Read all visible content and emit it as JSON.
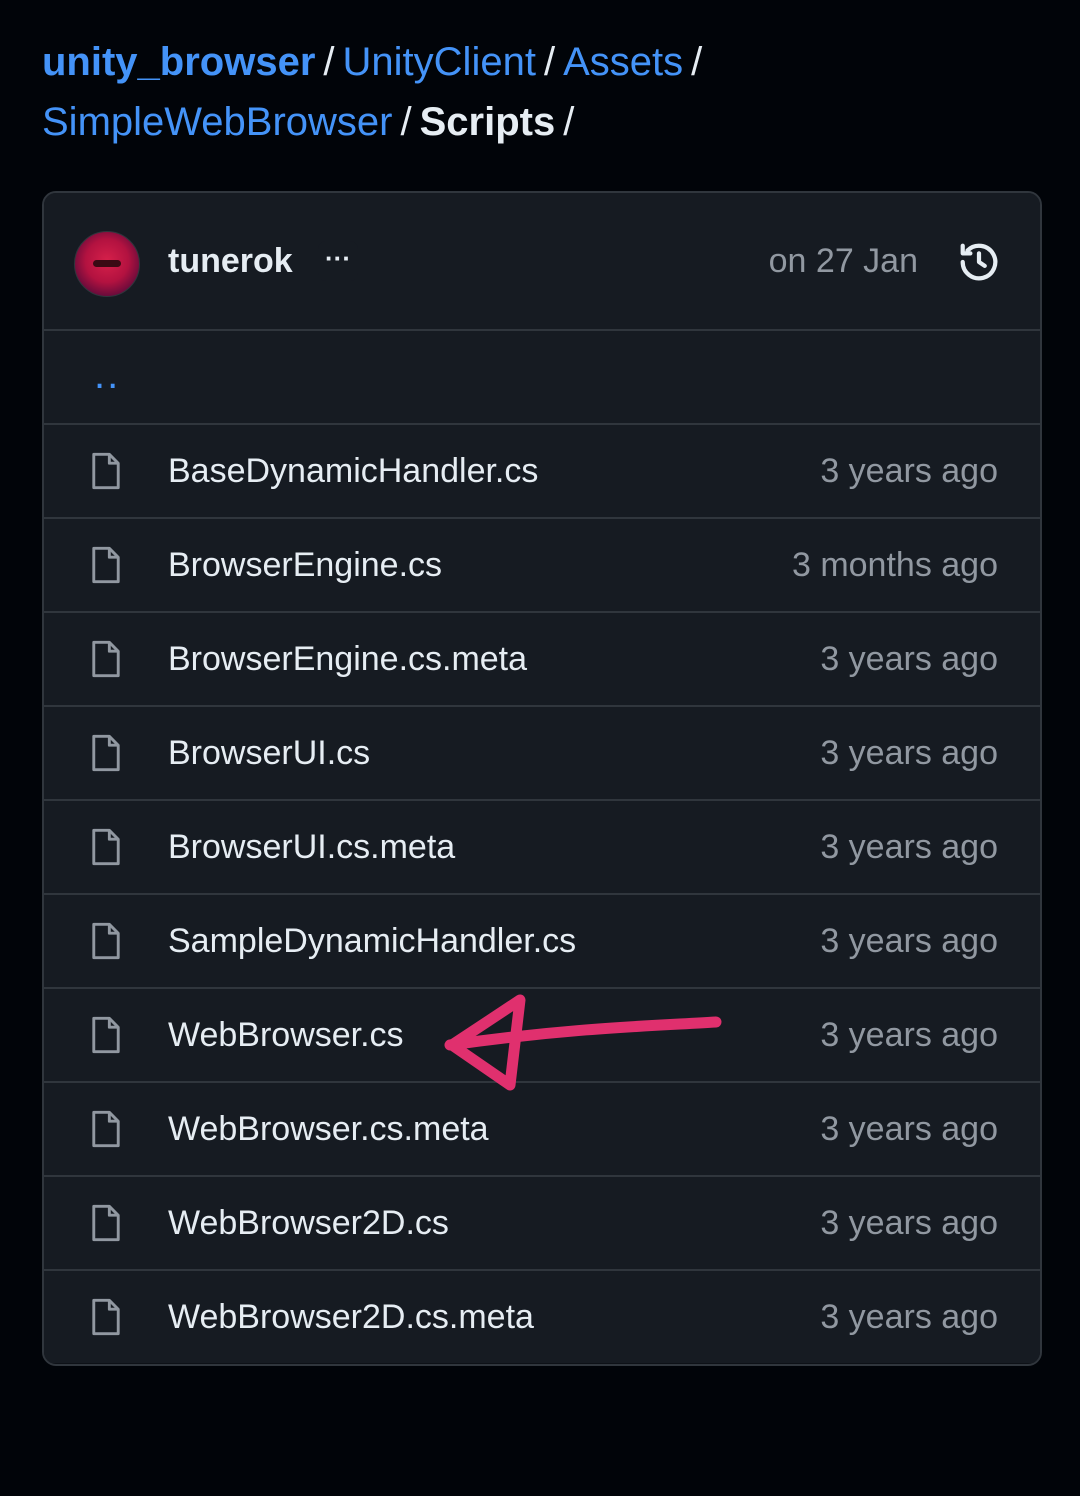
{
  "breadcrumb": {
    "repo": "unity_browser",
    "sep": "/",
    "items": [
      "UnityClient",
      "Assets",
      "SimpleWebBrowser"
    ],
    "current": "Scripts"
  },
  "commit": {
    "author": "tunerok",
    "more_label": "···",
    "date": "on 27 Jan",
    "history_icon": "history-icon"
  },
  "parent": {
    "label": ".."
  },
  "files": [
    {
      "name": "BaseDynamicHandler.cs",
      "age": "3 years ago"
    },
    {
      "name": "BrowserEngine.cs",
      "age": "3 months ago"
    },
    {
      "name": "BrowserEngine.cs.meta",
      "age": "3 years ago"
    },
    {
      "name": "BrowserUI.cs",
      "age": "3 years ago"
    },
    {
      "name": "BrowserUI.cs.meta",
      "age": "3 years ago"
    },
    {
      "name": "SampleDynamicHandler.cs",
      "age": "3 years ago"
    },
    {
      "name": "WebBrowser.cs",
      "age": "3 years ago"
    },
    {
      "name": "WebBrowser.cs.meta",
      "age": "3 years ago"
    },
    {
      "name": "WebBrowser2D.cs",
      "age": "3 years ago"
    },
    {
      "name": "WebBrowser2D.cs.meta",
      "age": "3 years ago"
    }
  ],
  "colors": {
    "background": "#010409",
    "link": "#4493f8",
    "annotation": "#e0306e"
  }
}
